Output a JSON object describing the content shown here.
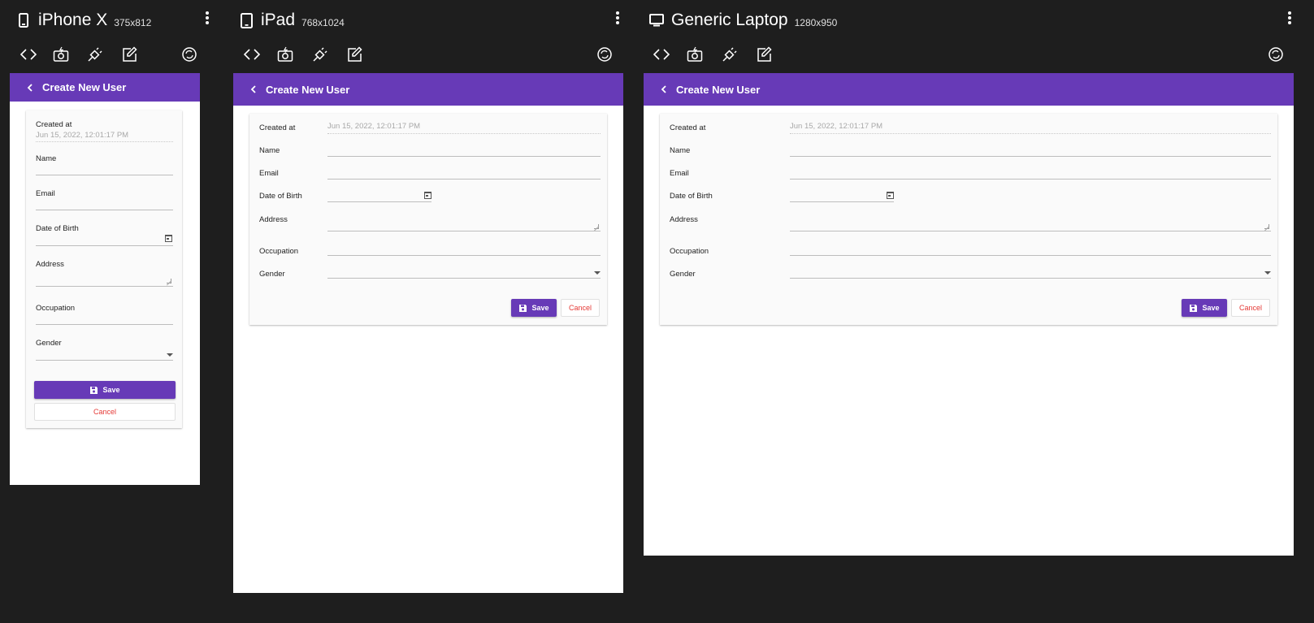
{
  "devices": [
    {
      "name": "iPhone X",
      "size": "375x812",
      "icon": "smartphone-icon"
    },
    {
      "name": "iPad",
      "size": "768x1024",
      "icon": "tablet-icon"
    },
    {
      "name": "Generic Laptop",
      "size": "1280x950",
      "icon": "laptop-icon"
    }
  ],
  "toolbar_icons": [
    "code-icon",
    "camera-flash-icon",
    "plug-icon",
    "edit-icon",
    "rotate-icon"
  ],
  "form": {
    "title": "Create New User",
    "created_label": "Created at",
    "created_value": "Jun 15, 2022, 12:01:17 PM",
    "name_label": "Name",
    "email_label": "Email",
    "dob_label": "Date of Birth",
    "address_label": "Address",
    "occupation_label": "Occupation",
    "gender_label": "Gender",
    "save_label": "Save",
    "cancel_label": "Cancel"
  },
  "colors": {
    "primary": "#673ab7",
    "background": "#1e1e1e",
    "cancel": "#e53935"
  }
}
